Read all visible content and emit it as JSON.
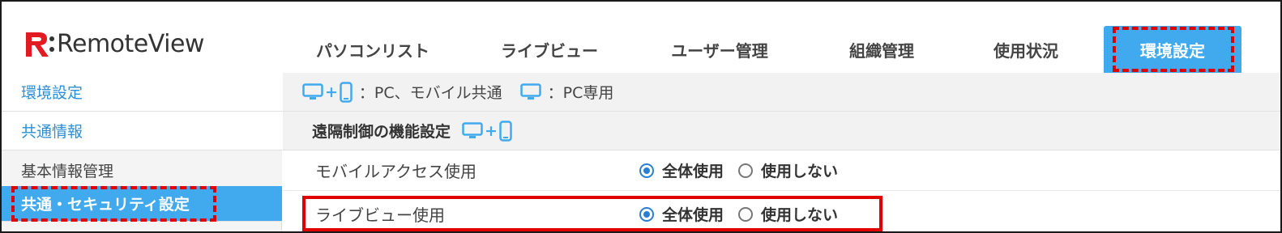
{
  "app": {
    "brand": "RemoteView"
  },
  "nav": {
    "tabs": [
      {
        "label": "パソコンリスト"
      },
      {
        "label": "ライブビュー"
      },
      {
        "label": "ユーザー管理"
      },
      {
        "label": "組織管理"
      },
      {
        "label": "使用状況"
      },
      {
        "label": "環境設定",
        "active": true
      }
    ]
  },
  "sidebar": {
    "items": [
      {
        "label": "環境設定"
      },
      {
        "label": "共通情報"
      },
      {
        "label": "基本情報管理"
      },
      {
        "label": "共通・セキュリティ設定",
        "selected": true
      }
    ]
  },
  "legend": {
    "pc_mobile": "：PC、モバイル共通",
    "pc_only": "：PC専用"
  },
  "section": {
    "title": "遠隔制御の機能設定"
  },
  "settings": [
    {
      "label": "モバイルアクセス使用",
      "option_all": "全体使用",
      "option_none": "使用しない",
      "selected": "option_all"
    },
    {
      "label": "ライブビュー使用",
      "option_all": "全体使用",
      "option_none": "使用しない",
      "selected": "option_all"
    }
  ],
  "colors": {
    "accent": "#41a9ee",
    "link": "#2a8fd6",
    "highlight": "#e00000",
    "brand_red": "#e21b23"
  },
  "icons": [
    "remoteview-logo-icon",
    "monitor-icon",
    "mobile-icon",
    "radio-selected-icon",
    "radio-unselected-icon"
  ]
}
